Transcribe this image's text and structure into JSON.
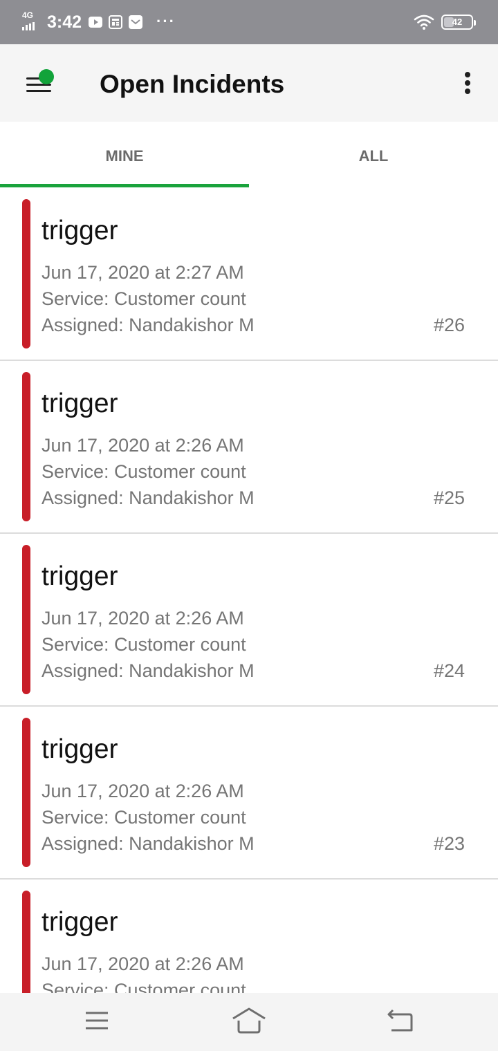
{
  "status_bar": {
    "network": "4G",
    "time": "3:42",
    "icons": [
      "youtube-icon",
      "news-icon",
      "mail-icon"
    ],
    "more": "···",
    "battery": "42",
    "battery_level": 0.42
  },
  "app_bar": {
    "title": "Open Incidents",
    "menu_icon": "hamburger-menu-icon",
    "overflow_icon": "more-vertical-icon",
    "status_dot_color": "#12a33a"
  },
  "tabs": [
    {
      "label": "MINE",
      "selected": true
    },
    {
      "label": "ALL",
      "selected": false
    }
  ],
  "colors": {
    "accent": "#1aa33c",
    "triggered_stripe": "#c81e28"
  },
  "incidents": [
    {
      "title": "trigger",
      "date": "Jun 17, 2020 at 2:27 AM",
      "service": "Service: Customer count",
      "assigned": "Assigned: Nandakishor M",
      "number": "#26"
    },
    {
      "title": "trigger",
      "date": "Jun 17, 2020 at 2:26 AM",
      "service": "Service: Customer count",
      "assigned": "Assigned: Nandakishor M",
      "number": "#25"
    },
    {
      "title": "trigger",
      "date": "Jun 17, 2020 at 2:26 AM",
      "service": "Service: Customer count",
      "assigned": "Assigned: Nandakishor M",
      "number": "#24"
    },
    {
      "title": "trigger",
      "date": "Jun 17, 2020 at 2:26 AM",
      "service": "Service: Customer count",
      "assigned": "Assigned: Nandakishor M",
      "number": "#23"
    },
    {
      "title": "trigger",
      "date": "Jun 17, 2020 at 2:26 AM",
      "service": "Service: Customer count",
      "assigned": "",
      "number": ""
    }
  ],
  "nav_bar": {
    "buttons": [
      "recents-menu-icon",
      "home-icon",
      "back-icon"
    ]
  }
}
